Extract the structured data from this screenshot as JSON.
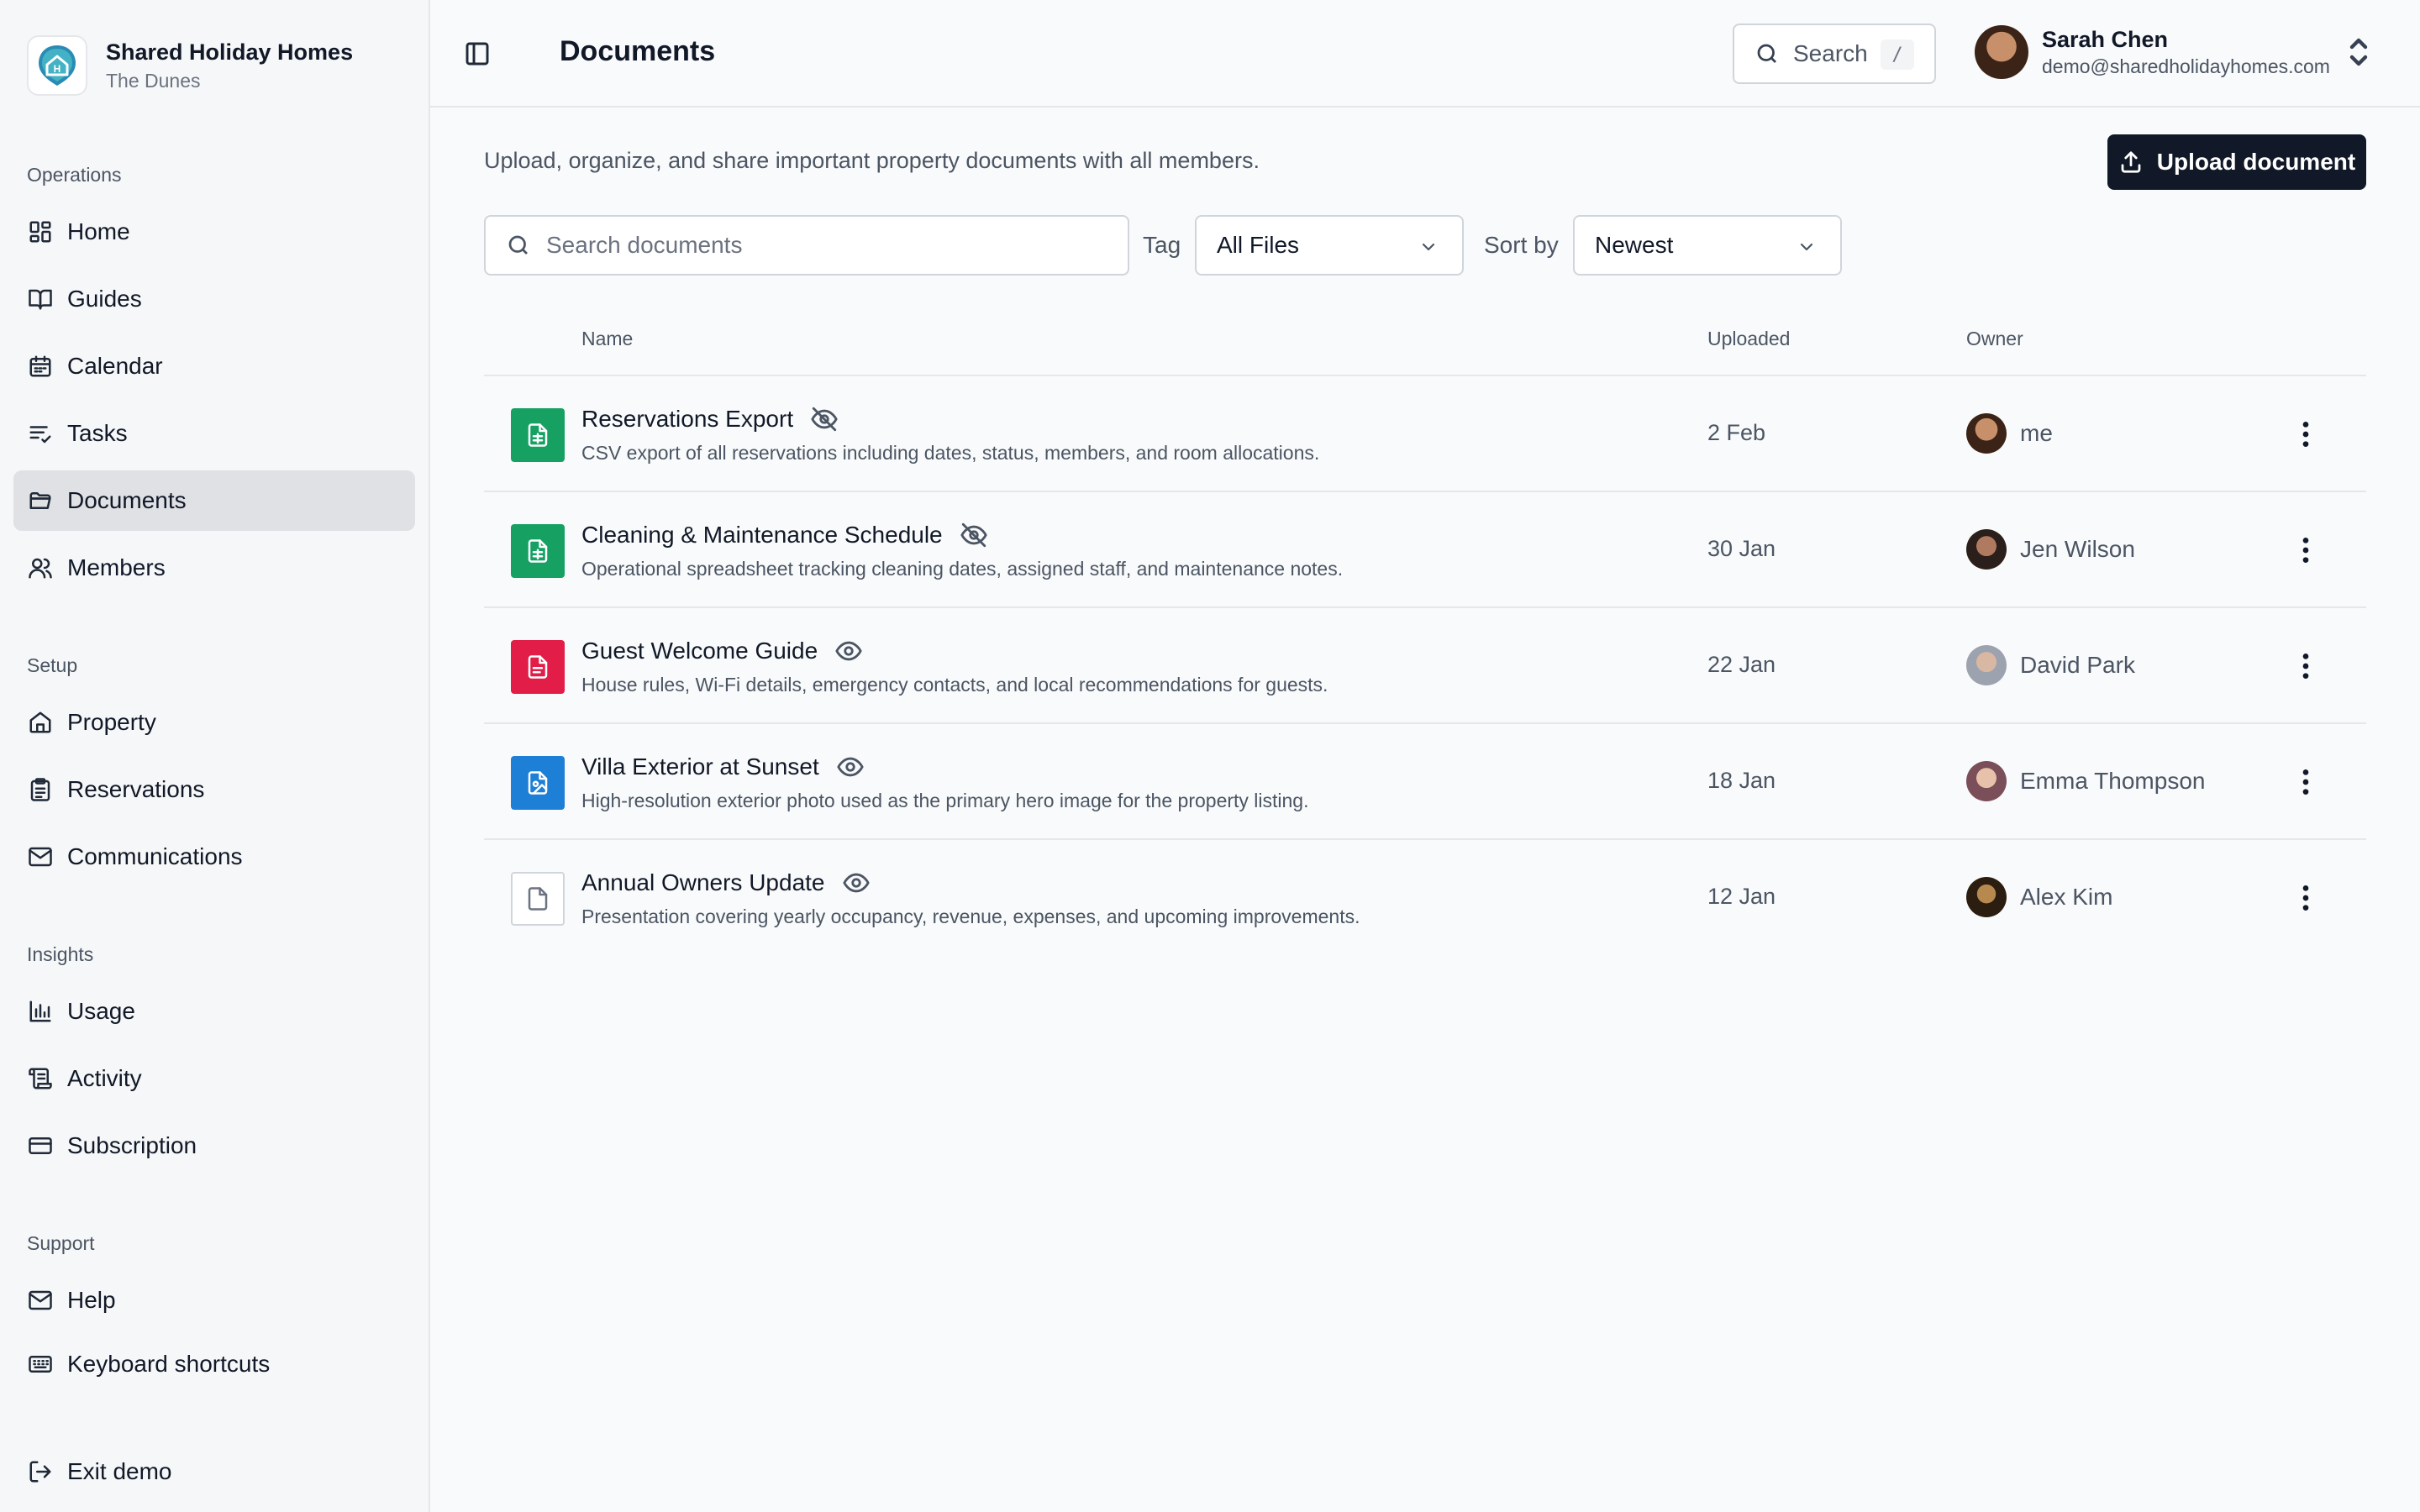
{
  "brand": {
    "name": "Shared Holiday Homes",
    "subtitle": "The Dunes",
    "logo_icon": "house-logo-icon"
  },
  "sidebar": {
    "sections": [
      {
        "label": "Operations",
        "items": [
          {
            "label": "Home",
            "icon": "dashboard-icon"
          },
          {
            "label": "Guides",
            "icon": "book-icon"
          },
          {
            "label": "Calendar",
            "icon": "calendar-icon"
          },
          {
            "label": "Tasks",
            "icon": "list-check-icon"
          },
          {
            "label": "Documents",
            "icon": "folder-icon",
            "active": true
          },
          {
            "label": "Members",
            "icon": "users-icon"
          }
        ]
      },
      {
        "label": "Setup",
        "items": [
          {
            "label": "Property",
            "icon": "house-icon"
          },
          {
            "label": "Reservations",
            "icon": "clipboard-icon"
          },
          {
            "label": "Communications",
            "icon": "mail-icon"
          }
        ]
      },
      {
        "label": "Insights",
        "items": [
          {
            "label": "Usage",
            "icon": "bar-chart-icon"
          },
          {
            "label": "Activity",
            "icon": "scroll-icon"
          },
          {
            "label": "Subscription",
            "icon": "credit-card-icon"
          }
        ]
      },
      {
        "label": "Support",
        "items": [
          {
            "label": "Help",
            "icon": "mail-icon"
          },
          {
            "label": "Keyboard shortcuts",
            "icon": "keyboard-icon"
          }
        ]
      }
    ],
    "exit": {
      "label": "Exit demo",
      "icon": "logout-icon"
    }
  },
  "header": {
    "title": "Documents",
    "search_label": "Search",
    "search_shortcut": "/",
    "user": {
      "name": "Sarah Chen",
      "email": "demo@sharedholidayhomes.com"
    }
  },
  "main": {
    "subtitle": "Upload, organize, and share important property documents with all members.",
    "upload_label": "Upload document",
    "search_placeholder": "Search documents",
    "tag_label": "Tag",
    "tag_value": "All Files",
    "sort_label": "Sort by",
    "sort_value": "Newest",
    "columns": {
      "name": "Name",
      "uploaded": "Uploaded",
      "owner": "Owner"
    },
    "documents": [
      {
        "title": "Reservations Export",
        "description": "CSV export of all reservations including dates, status, members, and room allocations.",
        "uploaded": "2 Feb",
        "owner": "me",
        "file_type": "spreadsheet",
        "visibility": "hidden"
      },
      {
        "title": "Cleaning & Maintenance Schedule",
        "description": "Operational spreadsheet tracking cleaning dates, assigned staff, and maintenance notes.",
        "uploaded": "30 Jan",
        "owner": "Jen Wilson",
        "file_type": "spreadsheet",
        "visibility": "hidden"
      },
      {
        "title": "Guest Welcome Guide",
        "description": "House rules, Wi-Fi details, emergency contacts, and local recommendations for guests.",
        "uploaded": "22 Jan",
        "owner": "David Park",
        "file_type": "pdf",
        "visibility": "visible"
      },
      {
        "title": "Villa Exterior at Sunset",
        "description": "High-resolution exterior photo used as the primary hero image for the property listing.",
        "uploaded": "18 Jan",
        "owner": "Emma Thompson",
        "file_type": "image",
        "visibility": "visible"
      },
      {
        "title": "Annual Owners Update",
        "description": "Presentation covering yearly occupancy, revenue, expenses, and upcoming improvements.",
        "uploaded": "12 Jan",
        "owner": "Alex Kim",
        "file_type": "generic",
        "visibility": "visible"
      }
    ]
  },
  "colors": {
    "spreadsheet": "#16a163",
    "pdf": "#e11d48",
    "image": "#1d7fd6",
    "primary_button": "#111827",
    "active_nav": "#dfe1e4"
  }
}
